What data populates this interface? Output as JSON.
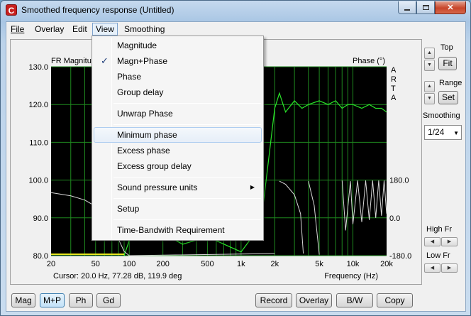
{
  "window": {
    "title": "Smoothed frequency response (Untitled)",
    "app_icon_glyph": "C"
  },
  "menubar": {
    "items": [
      "File",
      "Overlay",
      "Edit",
      "View",
      "Smoothing"
    ],
    "open_menu": "View"
  },
  "view_menu": {
    "items": [
      {
        "label": "Magnitude",
        "checked": false
      },
      {
        "label": "Magn+Phase",
        "checked": true
      },
      {
        "label": "Phase",
        "checked": false
      },
      {
        "label": "Group delay",
        "checked": false
      },
      {
        "label": "Unwrap Phase",
        "checked": false
      },
      {
        "label": "Minimum phase",
        "checked": false,
        "hovered": true
      },
      {
        "label": "Excess phase",
        "checked": false
      },
      {
        "label": "Excess group delay",
        "checked": false
      },
      {
        "label": "Sound pressure units",
        "has_submenu": true
      },
      {
        "label": "Setup",
        "checked": false
      },
      {
        "label": "Time-Bandwith Requirement",
        "checked": false
      }
    ],
    "check_glyph": "✓",
    "submenu_glyph": "▶"
  },
  "right_panel": {
    "top_label": "Top",
    "fit_button": "Fit",
    "range_label": "Range",
    "set_button": "Set",
    "smoothing_label": "Smoothing",
    "smoothing_value": "1/24",
    "high_fr_label": "High Fr",
    "low_fr_label": "Low Fr"
  },
  "bottom_buttons": {
    "mag": "Mag",
    "mp": "M+P",
    "ph": "Ph",
    "gd": "Gd",
    "record": "Record",
    "overlay": "Overlay",
    "bw": "B/W",
    "copy": "Copy"
  },
  "chart_data": {
    "type": "line",
    "title_left": "FR Magnitu",
    "title_right": "Phase (°)",
    "brand_vertical": [
      "A",
      "R",
      "T",
      "A"
    ],
    "xlabel": "Frequency (Hz)",
    "x_scale": "log",
    "xlim": [
      20,
      20000
    ],
    "x_ticks": [
      "20",
      "50",
      "100",
      "200",
      "500",
      "1k",
      "2k",
      "5k",
      "10k",
      "20k"
    ],
    "x_tick_values": [
      20,
      50,
      100,
      200,
      500,
      1000,
      2000,
      5000,
      10000,
      20000
    ],
    "ylim_left": [
      80,
      130
    ],
    "y_ticks_left": [
      "130.0",
      "120.0",
      "110.0",
      "100.0",
      "90.0",
      "80.0"
    ],
    "y_tick_values_left": [
      130,
      120,
      110,
      100,
      90,
      80
    ],
    "ylim_right": [
      -180,
      180
    ],
    "y_ticks_right": [
      "180.0",
      "0.0",
      "-180.0"
    ],
    "y_tick_values_right": [
      180,
      0,
      -180
    ],
    "cursor_text": "Cursor: 20.0 Hz, 77.28 dB, 119.9 deg",
    "grid": true,
    "colors": {
      "background": "#000000",
      "grid": "#1f8a1f",
      "magnitude": "#29e629",
      "phase": "#d8d8d8",
      "yellow": "#e6e61e"
    },
    "series": [
      {
        "name": "Magnitude",
        "x": [
          90,
          100,
          130,
          200,
          300,
          500,
          1000,
          1500,
          2000,
          2200,
          2500,
          3000,
          3500,
          4000,
          5000,
          6000,
          7000,
          8000,
          9000,
          10000,
          12000,
          14000,
          16000,
          18000,
          20000
        ],
        "values": [
          80,
          84,
          90,
          86,
          83,
          85,
          81,
          88,
          119,
          123,
          118,
          121,
          119,
          120,
          121,
          120,
          121,
          119,
          120,
          120,
          119,
          120,
          119,
          119,
          118
        ]
      },
      {
        "name": "Phase",
        "x": [
          20,
          30,
          40,
          50,
          60,
          70,
          80,
          90,
          100,
          2000,
          2200,
          2500,
          3000,
          3400,
          3600,
          4000,
          4500,
          5000,
          5200,
          6000,
          6500,
          7200,
          8000,
          8600,
          9500,
          10000,
          11000,
          12000,
          13000,
          14000,
          15000,
          16000,
          17000,
          18000,
          19000,
          20000
        ],
        "values": [
          120,
          105,
          85,
          55,
          20,
          -30,
          -100,
          -160,
          -180,
          -170,
          175,
          160,
          110,
          20,
          -170,
          175,
          60,
          -175,
          170,
          -120,
          175,
          -100,
          178,
          -60,
          175,
          -30,
          178,
          -20,
          178,
          -10,
          178,
          0,
          178,
          10,
          178,
          20
        ]
      }
    ]
  }
}
